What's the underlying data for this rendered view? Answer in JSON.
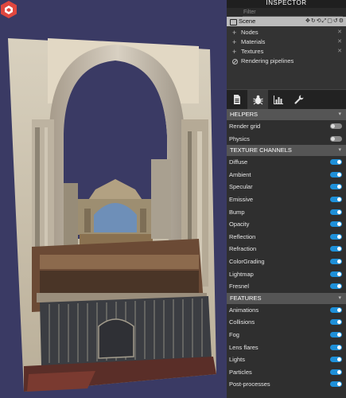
{
  "inspector": {
    "title": "INSPECTOR",
    "filter_placeholder": "Filter",
    "scene_label": "Scene",
    "tree": [
      {
        "label": "Nodes",
        "icon": "plus-icon"
      },
      {
        "label": "Materials",
        "icon": "plus-icon"
      },
      {
        "label": "Textures",
        "icon": "plus-icon"
      },
      {
        "label": "Rendering pipelines",
        "icon": "circle-slash-icon"
      }
    ],
    "tabs": [
      "properties-tab",
      "debug-tab",
      "statistics-tab",
      "tools-tab"
    ],
    "sections": {
      "helpers": {
        "title": "HELPERS",
        "items": [
          {
            "label": "Render grid",
            "on": false
          },
          {
            "label": "Physics",
            "on": false
          }
        ]
      },
      "texture_channels": {
        "title": "TEXTURE CHANNELS",
        "items": [
          {
            "label": "Diffuse",
            "on": true
          },
          {
            "label": "Ambient",
            "on": true
          },
          {
            "label": "Specular",
            "on": true
          },
          {
            "label": "Emissive",
            "on": true
          },
          {
            "label": "Bump",
            "on": true
          },
          {
            "label": "Opacity",
            "on": true
          },
          {
            "label": "Reflection",
            "on": true
          },
          {
            "label": "Refraction",
            "on": true
          },
          {
            "label": "ColorGrading",
            "on": true
          },
          {
            "label": "Lightmap",
            "on": true
          },
          {
            "label": "Fresnel",
            "on": true
          }
        ]
      },
      "features": {
        "title": "FEATURES",
        "items": [
          {
            "label": "Animations",
            "on": true
          },
          {
            "label": "Collisions",
            "on": true
          },
          {
            "label": "Fog",
            "on": true
          },
          {
            "label": "Lens flares",
            "on": true
          },
          {
            "label": "Lights",
            "on": true
          },
          {
            "label": "Particles",
            "on": true
          },
          {
            "label": "Post-processes",
            "on": true
          }
        ]
      }
    }
  },
  "colors": {
    "background": "#3a3a64",
    "toggle_on": "#1e90d9",
    "toggle_off": "#8a8a8a",
    "logo": "#e0473f"
  }
}
